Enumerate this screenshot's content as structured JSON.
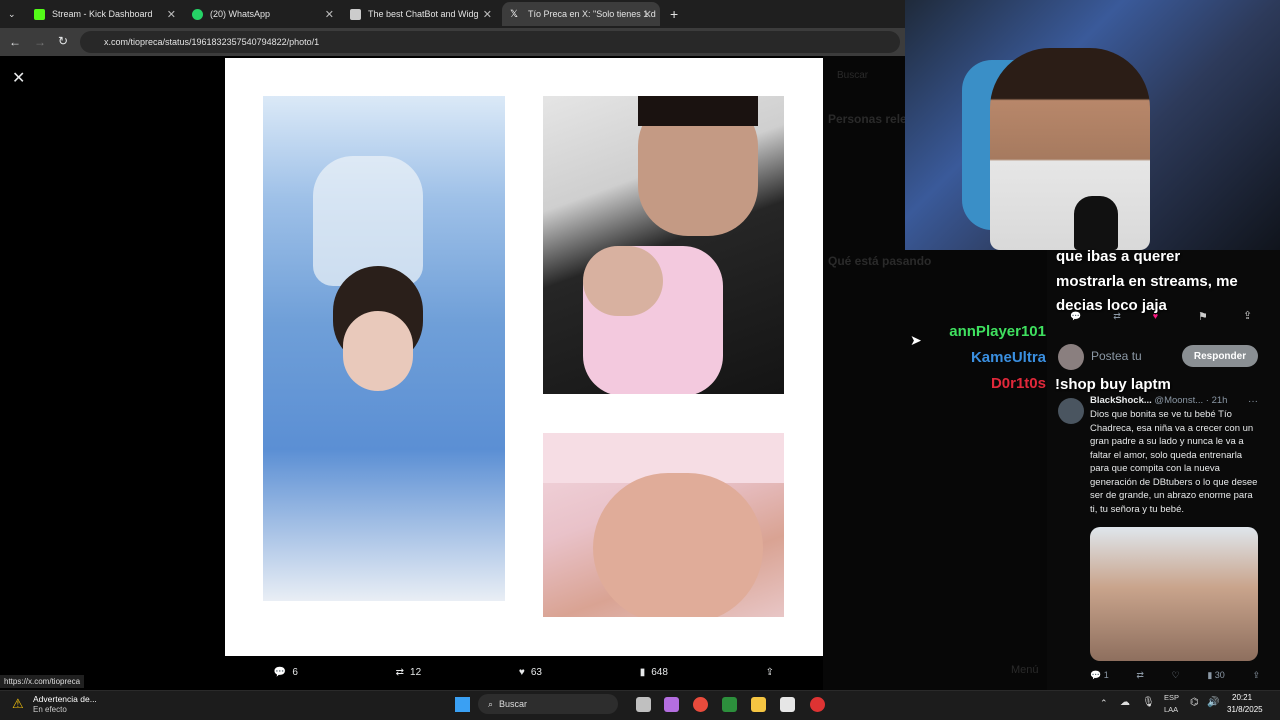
{
  "tabs": [
    {
      "label": "Stream - Kick Dashboard",
      "color": "#53fc18"
    },
    {
      "label": "(20) WhatsApp",
      "color": "#25d366"
    },
    {
      "label": "The best ChatBot and Widg",
      "color": "#cccccc"
    },
    {
      "label": "Tío Preca en X: \"Solo tienes 1 d",
      "color": "#ffffff"
    }
  ],
  "address": {
    "url": "x.com/tiopreca/status/1961832357540794822/photo/1"
  },
  "viewer": {
    "close_glyph": "✕",
    "actions": {
      "replies": "6",
      "reposts": "12",
      "likes": "63",
      "views": "648"
    }
  },
  "right_dim": {
    "search": "Buscar",
    "relevant": "Personas relevantes",
    "trending": "Qué está pasando",
    "menu": "Menú"
  },
  "stream_overlay": {
    "comment_lines": [
      "que ibas a querer",
      "mostrarla en streams, me",
      "decias loco jaja"
    ],
    "reply_placeholder": "Postea tu",
    "reply_button": "Responder",
    "shop_command": "!shop buy laptm",
    "chatters": [
      {
        "name": "annPlayer101",
        "color": "#3fe05f"
      },
      {
        "name": "KameUltra",
        "color": "#3a8fe0"
      },
      {
        "name": "D0r1t0s",
        "color": "#e0283a"
      }
    ],
    "tweet": {
      "author": "BlackShock...",
      "handle": "@Moonst...",
      "time": "· 21h",
      "body": "Dios que bonita se ve tu bebé Tío Chadreca, esa niña va a crecer con un gran padre a su lado y nunca le va a faltar el amor, solo queda entrenarla para que compita con la nueva generación de DBtubers o lo que desee ser de grande, un abrazo enorme para ti, tu señora y tu bebé.",
      "stats": {
        "replies": "1",
        "views": "30"
      }
    }
  },
  "status_link": "https://x.com/tiopreca",
  "taskbar": {
    "notice_title": "Advertencia de...",
    "notice_sub": "En efecto",
    "search": "Buscar",
    "lang1": "ESP",
    "lang2": "LAA",
    "time": "20:21",
    "date": "31/8/2025"
  }
}
